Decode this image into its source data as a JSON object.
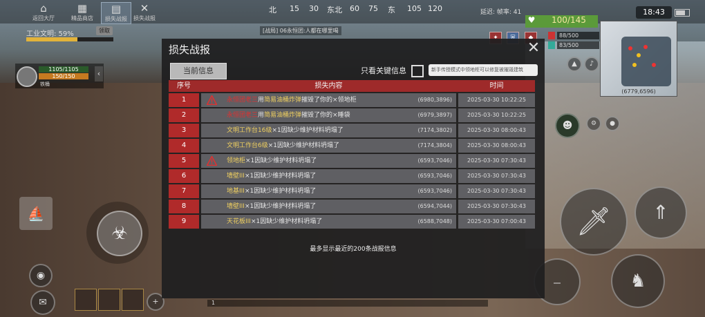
{
  "hud": {
    "top_buttons": [
      {
        "label": "返回大厅",
        "icon": "home-icon"
      },
      {
        "label": "精品商店",
        "icon": "shop-icon"
      },
      {
        "label": "损失战报",
        "icon": "report-icon"
      },
      {
        "label": "损失战报",
        "icon": "tools-icon"
      }
    ],
    "compass": [
      "北",
      "15",
      "30",
      "东北",
      "60",
      "75",
      "东",
      "105",
      "120"
    ],
    "chat_line": "[战局] 06永恒团:人都在哪里喝",
    "status_text": "延迟:  帧率: 41",
    "clock": "18:43",
    "civ_label": "工业文明: 59%",
    "civ_badge": "领取",
    "civ_progress": 0.59,
    "player": {
      "hp": "1105/1105",
      "sp": "150/150",
      "name": "铁桶"
    },
    "vitals": "100/145",
    "stat1": "88/500",
    "stat2": "83/500",
    "minimap_coords": "(6779,6596)",
    "bottom_strip": "1"
  },
  "dialog": {
    "title": "损失战报",
    "close": "✕",
    "tab_current": "当前信息",
    "filter_label": "只看关键信息",
    "hint": "新手传授模式中领地柜可以修复被摧毁建筑",
    "columns": {
      "idx": "序号",
      "content": "损失内容",
      "time": "时间"
    },
    "rows": [
      {
        "idx": "1",
        "warn": true,
        "actor": "永恒团老三",
        "text": "用",
        "item": "简易油桶炸弹",
        "tail": "摧毁了你的×领地柜",
        "coord": "(6980,3896)",
        "time": "2025-03-30 10:22:25"
      },
      {
        "idx": "2",
        "warn": false,
        "actor": "永恒团老三",
        "text": "用",
        "item": "简易油桶炸弹",
        "tail": "摧毁了你的×睡袋",
        "coord": "(6979,3897)",
        "time": "2025-03-30 10:22:25"
      },
      {
        "idx": "3",
        "warn": false,
        "actor": "",
        "text": "",
        "item": "文明工作台16级",
        "tail": "×1因缺少维护材料坍塌了",
        "coord": "(7174,3802)",
        "time": "2025-03-30 08:00:43"
      },
      {
        "idx": "4",
        "warn": false,
        "actor": "",
        "text": "",
        "item": "文明工作台6级",
        "tail": "×1因缺少维护材料坍塌了",
        "coord": "(7174,3804)",
        "time": "2025-03-30 08:00:43"
      },
      {
        "idx": "5",
        "warn": true,
        "actor": "",
        "text": "",
        "item": "领地柜",
        "tail": "×1因缺少维护材料坍塌了",
        "coord": "(6593,7046)",
        "time": "2025-03-30 07:30:43"
      },
      {
        "idx": "6",
        "warn": false,
        "actor": "",
        "text": "",
        "item": "墙壁III",
        "tail": "×1因缺少维护材料坍塌了",
        "coord": "(6593,7046)",
        "time": "2025-03-30 07:30:43"
      },
      {
        "idx": "7",
        "warn": false,
        "actor": "",
        "text": "",
        "item": "地基III",
        "tail": "×1因缺少维护材料坍塌了",
        "coord": "(6593,7046)",
        "time": "2025-03-30 07:30:43"
      },
      {
        "idx": "8",
        "warn": false,
        "actor": "",
        "text": "",
        "item": "墙壁III",
        "tail": "×1因缺少维护材料坍塌了",
        "coord": "(6594,7044)",
        "time": "2025-03-30 07:30:43"
      },
      {
        "idx": "9",
        "warn": false,
        "actor": "",
        "text": "",
        "item": "天花板III",
        "tail": "×1因缺少维护材料坍塌了",
        "coord": "(6588,7048)",
        "time": "2025-03-30 07:00:43"
      }
    ],
    "footer": "最多显示最近的200条战报信息"
  },
  "colors": {
    "header_red": "#9e2a2a",
    "index_red": "#b02a2a",
    "actor_red": "#e03030",
    "item_yellow": "#f0d060"
  }
}
